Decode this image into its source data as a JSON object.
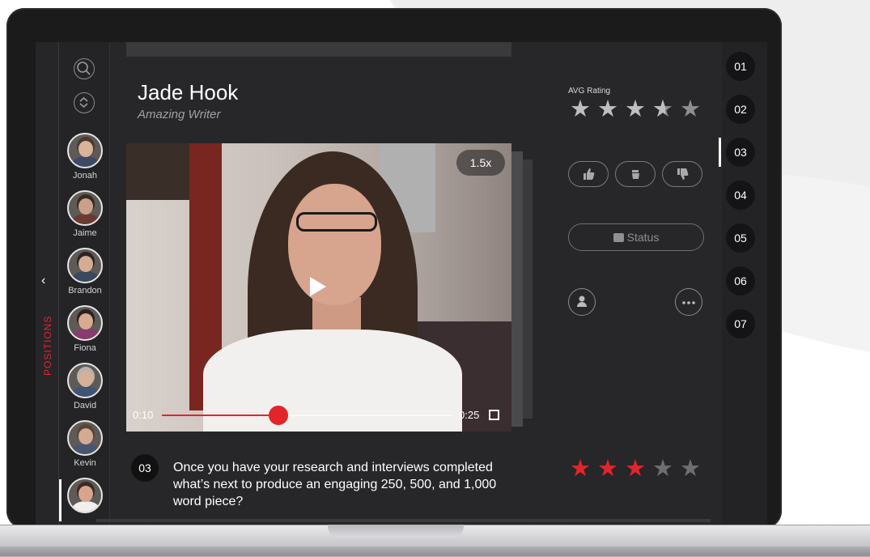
{
  "candidate": {
    "name": "Jade Hook",
    "role": "Amazing Writer"
  },
  "sidebar": {
    "label": "POSITIONS",
    "people": [
      {
        "name": "Jonah",
        "skin": "#d9b49b",
        "shirt": "#3d4a66",
        "hair": "#4b3a2e"
      },
      {
        "name": "Jaime",
        "skin": "#caa08a",
        "shirt": "#6a3b33",
        "hair": "#3a2a22"
      },
      {
        "name": "Brandon",
        "skin": "#d3ad93",
        "shirt": "#39495e",
        "hair": "#2d2420"
      },
      {
        "name": "Fiona",
        "skin": "#d8aa8f",
        "shirt": "#8a3a6e",
        "hair": "#2b211d"
      },
      {
        "name": "David",
        "skin": "#d7b09a",
        "shirt": "#3f5476",
        "hair": "#b9b1aa"
      },
      {
        "name": "Kevin",
        "skin": "#d4ab92",
        "shirt": "#485670",
        "hair": "#5b4432"
      },
      {
        "name": "",
        "skin": "#d7a48e",
        "shirt": "#f1f0ee",
        "hair": "#3a2a22"
      }
    ]
  },
  "video": {
    "speed": "1.5x",
    "current_time": "0:10",
    "total_time": "0:25",
    "progress": 0.4
  },
  "avg_rating": {
    "label": "AVG Rating",
    "value": 3.5,
    "max": 5
  },
  "status_label": "Status",
  "question": {
    "number": "03",
    "text": "Once you have your research and interviews completed what’s next to produce an engaging 250, 500, and 1,000 word piece?",
    "rating": 3,
    "max": 5
  },
  "steps": [
    "01",
    "02",
    "03",
    "04",
    "05",
    "06",
    "07"
  ],
  "active_step": "03",
  "icons": {
    "search": "search-icon",
    "sort": "sort-icon",
    "chevron": "chevron-left-icon",
    "thumbs_up": "thumbs-up-icon",
    "neutral": "thumbs-sideways-icon",
    "thumbs_down": "thumbs-down-icon",
    "status": "briefcase-icon",
    "profile": "user-icon",
    "more": "more-icon"
  },
  "colors": {
    "accent": "#e2252b",
    "panel": "#27272a"
  }
}
